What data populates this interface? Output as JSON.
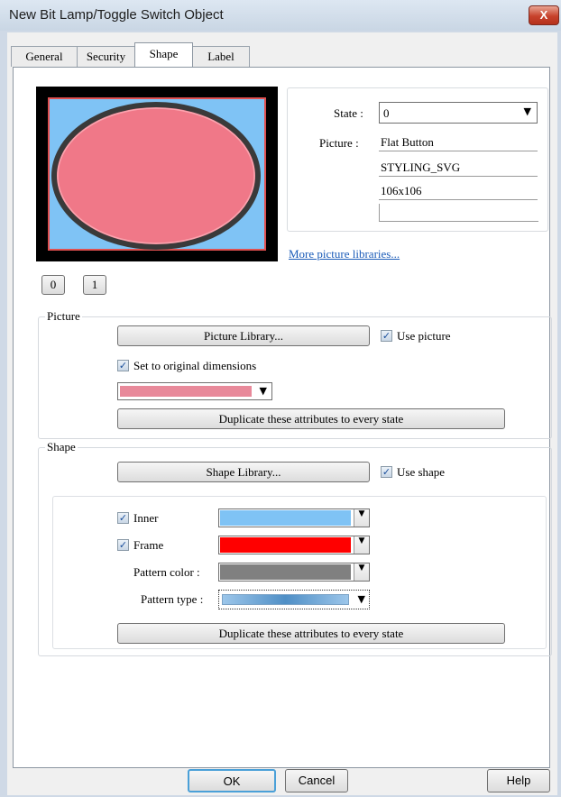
{
  "window": {
    "title": "New Bit Lamp/Toggle Switch Object",
    "close_glyph": "X"
  },
  "tabs": [
    {
      "label": "General",
      "active": false
    },
    {
      "label": "Security",
      "active": false
    },
    {
      "label": "Shape",
      "active": true
    },
    {
      "label": "Label",
      "active": false
    }
  ],
  "state": {
    "label": "State :",
    "value": "0"
  },
  "picture_info": {
    "label": "Picture :",
    "name": "Flat Button",
    "library": "STYLING_SVG",
    "size": "106x106",
    "extra": ""
  },
  "more_libraries_link": "More picture libraries...",
  "state_buttons": [
    "0",
    "1"
  ],
  "picture_group": {
    "label": "Picture",
    "library_button": "Picture Library...",
    "use_picture_label": "Use picture",
    "use_picture_checked": true,
    "original_dimensions_label": "Set to original dimensions",
    "original_dimensions_checked": true,
    "color_swatch": "#e8899a",
    "duplicate_button": "Duplicate these attributes to every state"
  },
  "shape_group": {
    "label": "Shape",
    "library_button": "Shape Library...",
    "use_shape_label": "Use shape",
    "use_shape_checked": true,
    "inner_label": "Inner",
    "inner_checked": true,
    "inner_color": "#7fc3f5",
    "frame_label": "Frame",
    "frame_checked": true,
    "frame_color": "#ff0000",
    "pattern_color_label": "Pattern color :",
    "pattern_color": "#808080",
    "pattern_type_label": "Pattern type :",
    "duplicate_button": "Duplicate these attributes to every state"
  },
  "preview": {
    "background": "#000000",
    "inner_color": "#7fc3f5",
    "frame_color": "#e05050",
    "ellipse_color": "#f07888",
    "ellipse_outline": "#3a3a3a"
  },
  "footer": {
    "ok": "OK",
    "cancel": "Cancel",
    "help": "Help"
  }
}
